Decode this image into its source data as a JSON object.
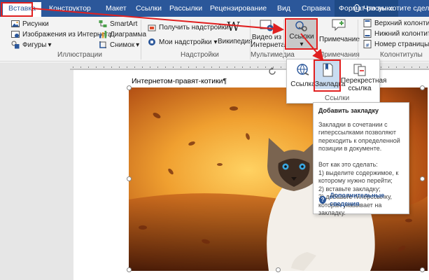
{
  "tabs": [
    {
      "label": "Вставка",
      "active": true
    },
    {
      "label": "Конструктор"
    },
    {
      "label": "Макет"
    },
    {
      "label": "Ссылки"
    },
    {
      "label": "Рассылки"
    },
    {
      "label": "Рецензирование"
    },
    {
      "label": "Вид"
    },
    {
      "label": "Справка"
    },
    {
      "label": "Формат рисунка",
      "contextual": true
    }
  ],
  "tell_me": "Что вы хотите сделать?",
  "ribbon": {
    "illustrations": {
      "pictures": "Рисунки",
      "online_pictures": "Изображения из Интернета",
      "shapes": "Фигуры",
      "smartart": "SmartArt",
      "chart": "Диаграмма",
      "screenshot": "Снимок",
      "group_label": "Иллюстрации"
    },
    "addins": {
      "get_addins": "Получить надстройки",
      "my_addins": "Мои надстройки",
      "wikipedia": "Википедия",
      "group_label": "Надстройки"
    },
    "media": {
      "online_video_line1": "Видео из",
      "online_video_line2": "Интернета",
      "group_label": "Мультимедиа"
    },
    "links": {
      "links_button": "Ссылки",
      "group_label": "Ссылки"
    },
    "comments": {
      "comment": "Примечание",
      "group_label": "Примечания"
    },
    "header_footer": {
      "header": "Верхний колонтитул",
      "footer": "Нижний колонтитул",
      "page_number": "Номер страницы",
      "group_label": "Колонтитулы"
    }
  },
  "dropdown": {
    "link": "Ссылка",
    "bookmark": "Закладка",
    "cross_ref_line1": "Перекрестная",
    "cross_ref_line2": "ссылка",
    "group_label": "Ссылки"
  },
  "tooltip": {
    "title": "Добавить закладку",
    "body": "Закладки в сочетании с гиперссылками позволяют переходить к определенной позиции в документе.\n\nВот как это сделать:\n1) выделите содержимое, к которому нужно перейти;\n2) вставьте закладку;\n3) добавьте гиперссылку, которая указывает на закладку.",
    "more": "Дополнительные сведения"
  },
  "document": {
    "paragraph": "Интернетом-правят-котики¶"
  },
  "colors": {
    "accent": "#2b579a",
    "highlight": "#e02020"
  }
}
